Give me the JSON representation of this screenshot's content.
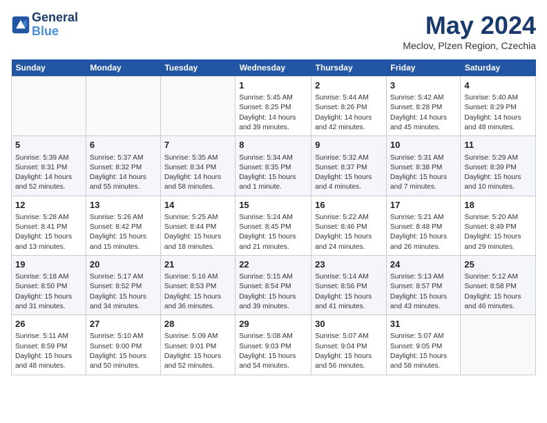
{
  "header": {
    "logo_line1": "General",
    "logo_line2": "Blue",
    "month_title": "May 2024",
    "location": "Meclov, Plzen Region, Czechia"
  },
  "days_of_week": [
    "Sunday",
    "Monday",
    "Tuesday",
    "Wednesday",
    "Thursday",
    "Friday",
    "Saturday"
  ],
  "weeks": [
    [
      {
        "day": "",
        "empty": true
      },
      {
        "day": "",
        "empty": true
      },
      {
        "day": "",
        "empty": true
      },
      {
        "day": "1",
        "sunrise": "5:45 AM",
        "sunset": "8:25 PM",
        "daylight": "14 hours and 39 minutes."
      },
      {
        "day": "2",
        "sunrise": "5:44 AM",
        "sunset": "8:26 PM",
        "daylight": "14 hours and 42 minutes."
      },
      {
        "day": "3",
        "sunrise": "5:42 AM",
        "sunset": "8:28 PM",
        "daylight": "14 hours and 45 minutes."
      },
      {
        "day": "4",
        "sunrise": "5:40 AM",
        "sunset": "8:29 PM",
        "daylight": "14 hours and 48 minutes."
      }
    ],
    [
      {
        "day": "5",
        "sunrise": "5:39 AM",
        "sunset": "8:31 PM",
        "daylight": "14 hours and 52 minutes."
      },
      {
        "day": "6",
        "sunrise": "5:37 AM",
        "sunset": "8:32 PM",
        "daylight": "14 hours and 55 minutes."
      },
      {
        "day": "7",
        "sunrise": "5:35 AM",
        "sunset": "8:34 PM",
        "daylight": "14 hours and 58 minutes."
      },
      {
        "day": "8",
        "sunrise": "5:34 AM",
        "sunset": "8:35 PM",
        "daylight": "15 hours and 1 minute."
      },
      {
        "day": "9",
        "sunrise": "5:32 AM",
        "sunset": "8:37 PM",
        "daylight": "15 hours and 4 minutes."
      },
      {
        "day": "10",
        "sunrise": "5:31 AM",
        "sunset": "8:38 PM",
        "daylight": "15 hours and 7 minutes."
      },
      {
        "day": "11",
        "sunrise": "5:29 AM",
        "sunset": "8:39 PM",
        "daylight": "15 hours and 10 minutes."
      }
    ],
    [
      {
        "day": "12",
        "sunrise": "5:28 AM",
        "sunset": "8:41 PM",
        "daylight": "15 hours and 13 minutes."
      },
      {
        "day": "13",
        "sunrise": "5:26 AM",
        "sunset": "8:42 PM",
        "daylight": "15 hours and 15 minutes."
      },
      {
        "day": "14",
        "sunrise": "5:25 AM",
        "sunset": "8:44 PM",
        "daylight": "15 hours and 18 minutes."
      },
      {
        "day": "15",
        "sunrise": "5:24 AM",
        "sunset": "8:45 PM",
        "daylight": "15 hours and 21 minutes."
      },
      {
        "day": "16",
        "sunrise": "5:22 AM",
        "sunset": "8:46 PM",
        "daylight": "15 hours and 24 minutes."
      },
      {
        "day": "17",
        "sunrise": "5:21 AM",
        "sunset": "8:48 PM",
        "daylight": "15 hours and 26 minutes."
      },
      {
        "day": "18",
        "sunrise": "5:20 AM",
        "sunset": "8:49 PM",
        "daylight": "15 hours and 29 minutes."
      }
    ],
    [
      {
        "day": "19",
        "sunrise": "5:18 AM",
        "sunset": "8:50 PM",
        "daylight": "15 hours and 31 minutes."
      },
      {
        "day": "20",
        "sunrise": "5:17 AM",
        "sunset": "8:52 PM",
        "daylight": "15 hours and 34 minutes."
      },
      {
        "day": "21",
        "sunrise": "5:16 AM",
        "sunset": "8:53 PM",
        "daylight": "15 hours and 36 minutes."
      },
      {
        "day": "22",
        "sunrise": "5:15 AM",
        "sunset": "8:54 PM",
        "daylight": "15 hours and 39 minutes."
      },
      {
        "day": "23",
        "sunrise": "5:14 AM",
        "sunset": "8:56 PM",
        "daylight": "15 hours and 41 minutes."
      },
      {
        "day": "24",
        "sunrise": "5:13 AM",
        "sunset": "8:57 PM",
        "daylight": "15 hours and 43 minutes."
      },
      {
        "day": "25",
        "sunrise": "5:12 AM",
        "sunset": "8:58 PM",
        "daylight": "15 hours and 46 minutes."
      }
    ],
    [
      {
        "day": "26",
        "sunrise": "5:11 AM",
        "sunset": "8:59 PM",
        "daylight": "15 hours and 48 minutes."
      },
      {
        "day": "27",
        "sunrise": "5:10 AM",
        "sunset": "9:00 PM",
        "daylight": "15 hours and 50 minutes."
      },
      {
        "day": "28",
        "sunrise": "5:09 AM",
        "sunset": "9:01 PM",
        "daylight": "15 hours and 52 minutes."
      },
      {
        "day": "29",
        "sunrise": "5:08 AM",
        "sunset": "9:03 PM",
        "daylight": "15 hours and 54 minutes."
      },
      {
        "day": "30",
        "sunrise": "5:07 AM",
        "sunset": "9:04 PM",
        "daylight": "15 hours and 56 minutes."
      },
      {
        "day": "31",
        "sunrise": "5:07 AM",
        "sunset": "9:05 PM",
        "daylight": "15 hours and 58 minutes."
      },
      {
        "day": "",
        "empty": true
      }
    ]
  ]
}
